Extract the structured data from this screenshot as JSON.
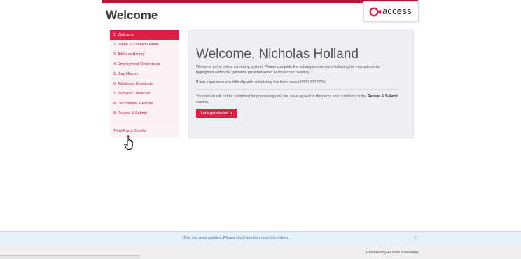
{
  "header": {
    "title": "Welcome",
    "logo_text": "access"
  },
  "colors": {
    "brand": "#dd1f47",
    "brand_dark": "#b8173a",
    "panel": "#efeff3"
  },
  "sidebar": {
    "items": [
      {
        "label": "1. Welcome"
      },
      {
        "label": "2. Name & Contact Details"
      },
      {
        "label": "3. Address History"
      },
      {
        "label": "4. Employment References"
      },
      {
        "label": "5. Gap History"
      },
      {
        "label": "6. Additional Questions"
      },
      {
        "label": "7. Supplied Literature"
      },
      {
        "label": "8. Documents & Forms"
      },
      {
        "label": "9. Review & Submit"
      }
    ],
    "third_party": "Third Party Checks"
  },
  "main": {
    "heading": "Welcome, Nicholas Holland",
    "intro": "Welcome to the online screening system. Please complete the subsequent sections following the instructions as highlighted within the guidance provided within each section heading.",
    "difficulty": "If you experience any difficulty with completing this form please 0000 000 0000.",
    "terms_prefix": "Your details will not be submitted for processing until you have agreed to the terms and conditions in the",
    "terms_bold": "Review & Submit",
    "terms_suffix": "section.",
    "start_button": "Let's get started",
    "start_icon": "arrow-right-icon"
  },
  "cookie": {
    "text": "This site uses cookies. Please click here for more information.",
    "close": "×"
  },
  "footer": {
    "powered_by": "Powered by Access Screening."
  }
}
